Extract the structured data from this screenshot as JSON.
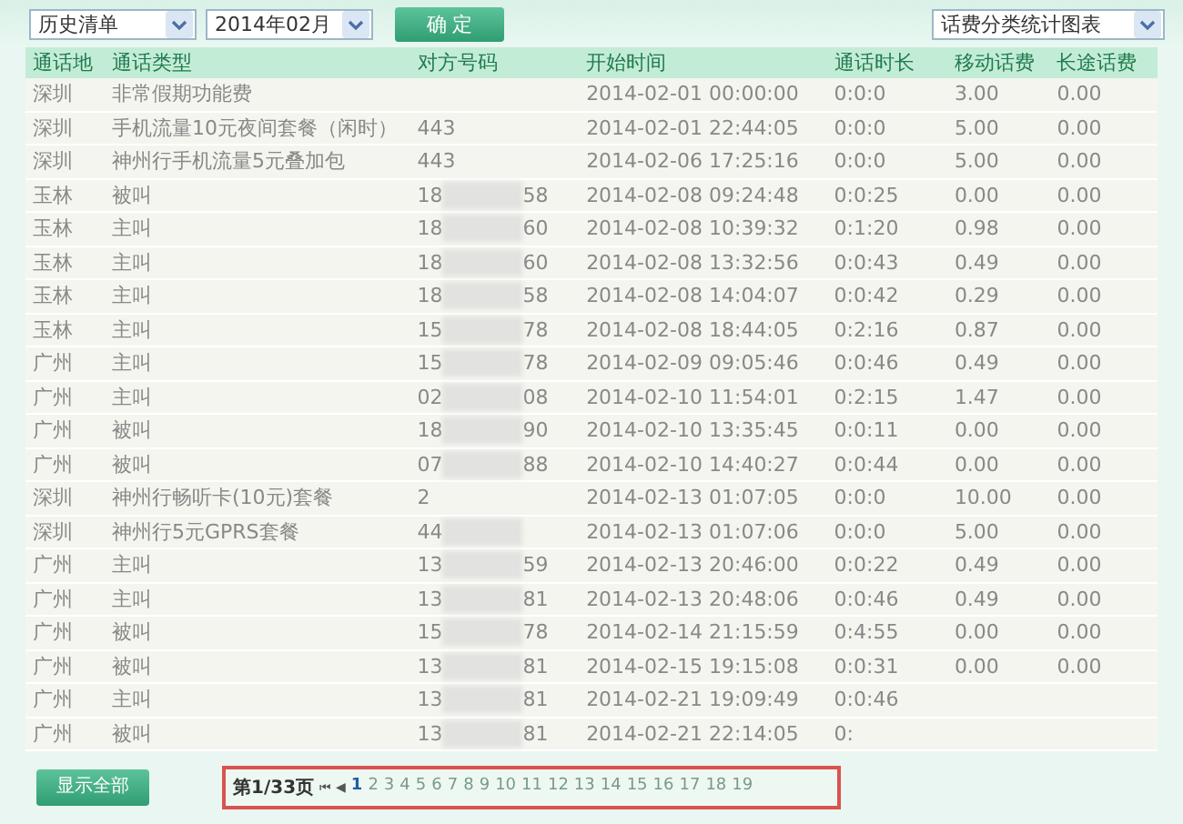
{
  "filters": {
    "list_type": "历史清单",
    "month": "2014年02月",
    "confirm": "确 定",
    "chart_select": "话费分类统计图表"
  },
  "table": {
    "columns": [
      "通话地",
      "通话类型",
      "对方号码",
      "开始时间",
      "通话时长",
      "移动话费",
      "长途话费"
    ],
    "rows": [
      {
        "place": "深圳",
        "type": "非常假期功能费",
        "number_start": "",
        "number_end": "",
        "blurred": false,
        "start": "2014-02-01 00:00:00",
        "duration": "0:0:0",
        "mobile_fee": "3.00",
        "long_fee": "0.00"
      },
      {
        "place": "深圳",
        "type": "手机流量10元夜间套餐（闲时）",
        "number_start": "443",
        "number_end": "",
        "blurred": false,
        "start": "2014-02-01 22:44:05",
        "duration": "0:0:0",
        "mobile_fee": "5.00",
        "long_fee": "0.00"
      },
      {
        "place": "深圳",
        "type": "神州行手机流量5元叠加包",
        "number_start": "443",
        "number_end": "",
        "blurred": false,
        "start": "2014-02-06 17:25:16",
        "duration": "0:0:0",
        "mobile_fee": "5.00",
        "long_fee": "0.00"
      },
      {
        "place": "玉林",
        "type": "被叫",
        "number_start": "18",
        "number_end": "58",
        "blurred": true,
        "start": "2014-02-08 09:24:48",
        "duration": "0:0:25",
        "mobile_fee": "0.00",
        "long_fee": "0.00"
      },
      {
        "place": "玉林",
        "type": "主叫",
        "number_start": "18",
        "number_end": "60",
        "blurred": true,
        "start": "2014-02-08 10:39:32",
        "duration": "0:1:20",
        "mobile_fee": "0.98",
        "long_fee": "0.00"
      },
      {
        "place": "玉林",
        "type": "主叫",
        "number_start": "18",
        "number_end": "60",
        "blurred": true,
        "start": "2014-02-08 13:32:56",
        "duration": "0:0:43",
        "mobile_fee": "0.49",
        "long_fee": "0.00"
      },
      {
        "place": "玉林",
        "type": "主叫",
        "number_start": "18",
        "number_end": "58",
        "blurred": true,
        "start": "2014-02-08 14:04:07",
        "duration": "0:0:42",
        "mobile_fee": "0.29",
        "long_fee": "0.00"
      },
      {
        "place": "玉林",
        "type": "主叫",
        "number_start": "15",
        "number_end": "78",
        "blurred": true,
        "start": "2014-02-08 18:44:05",
        "duration": "0:2:16",
        "mobile_fee": "0.87",
        "long_fee": "0.00"
      },
      {
        "place": "广州",
        "type": "主叫",
        "number_start": "15",
        "number_end": "78",
        "blurred": true,
        "start": "2014-02-09 09:05:46",
        "duration": "0:0:46",
        "mobile_fee": "0.49",
        "long_fee": "0.00"
      },
      {
        "place": "广州",
        "type": "主叫",
        "number_start": "02",
        "number_end": "08",
        "blurred": true,
        "start": "2014-02-10 11:54:01",
        "duration": "0:2:15",
        "mobile_fee": "1.47",
        "long_fee": "0.00"
      },
      {
        "place": "广州",
        "type": "被叫",
        "number_start": "18",
        "number_end": "90",
        "blurred": true,
        "start": "2014-02-10 13:35:45",
        "duration": "0:0:11",
        "mobile_fee": "0.00",
        "long_fee": "0.00"
      },
      {
        "place": "广州",
        "type": "被叫",
        "number_start": "07",
        "number_end": "88",
        "blurred": true,
        "start": "2014-02-10 14:40:27",
        "duration": "0:0:44",
        "mobile_fee": "0.00",
        "long_fee": "0.00"
      },
      {
        "place": "深圳",
        "type": "神州行畅听卡(10元)套餐",
        "number_start": "2",
        "number_end": "",
        "blurred": false,
        "start": "2014-02-13 01:07:05",
        "duration": "0:0:0",
        "mobile_fee": "10.00",
        "long_fee": "0.00"
      },
      {
        "place": "深圳",
        "type": "神州行5元GPRS套餐",
        "number_start": "44",
        "number_end": "",
        "blurred": true,
        "start": "2014-02-13 01:07:06",
        "duration": "0:0:0",
        "mobile_fee": "5.00",
        "long_fee": "0.00"
      },
      {
        "place": "广州",
        "type": "主叫",
        "number_start": "13",
        "number_end": "59",
        "blurred": true,
        "start": "2014-02-13 20:46:00",
        "duration": "0:0:22",
        "mobile_fee": "0.49",
        "long_fee": "0.00"
      },
      {
        "place": "广州",
        "type": "主叫",
        "number_start": "13",
        "number_end": "81",
        "blurred": true,
        "start": "2014-02-13 20:48:06",
        "duration": "0:0:46",
        "mobile_fee": "0.49",
        "long_fee": "0.00"
      },
      {
        "place": "广州",
        "type": "被叫",
        "number_start": "15",
        "number_end": "78",
        "blurred": true,
        "start": "2014-02-14 21:15:59",
        "duration": "0:4:55",
        "mobile_fee": "0.00",
        "long_fee": "0.00"
      },
      {
        "place": "广州",
        "type": "被叫",
        "number_start": "13",
        "number_end": "81",
        "blurred": true,
        "start": "2014-02-15 19:15:08",
        "duration": "0:0:31",
        "mobile_fee": "0.00",
        "long_fee": "0.00"
      },
      {
        "place": "广州",
        "type": "主叫",
        "number_start": "13",
        "number_end": "81",
        "blurred": true,
        "start": "2014-02-21 19:09:49",
        "duration": "0:0:46",
        "mobile_fee": "",
        "long_fee": ""
      },
      {
        "place": "广州",
        "type": "被叫",
        "number_start": "13",
        "number_end": "81",
        "blurred": true,
        "start": "2014-02-21 22:14:05",
        "duration": "0:",
        "mobile_fee": "",
        "long_fee": ""
      }
    ]
  },
  "footer": {
    "show_all": "显示全部",
    "page_info": "第1/33页",
    "first": "⏮",
    "prev": "◀",
    "pages": [
      {
        "label": "1",
        "selected": true
      },
      {
        "label": "2",
        "selected": false
      },
      {
        "label": "3",
        "selected": false
      },
      {
        "label": "4",
        "selected": false
      },
      {
        "label": "5",
        "selected": false
      },
      {
        "label": "6",
        "selected": false
      },
      {
        "label": "7",
        "selected": false
      },
      {
        "label": "8",
        "selected": false
      },
      {
        "label": "9",
        "selected": false
      },
      {
        "label": "10",
        "selected": false
      },
      {
        "label": "11",
        "selected": false
      },
      {
        "label": "12",
        "selected": false
      },
      {
        "label": "13",
        "selected": false
      },
      {
        "label": "14",
        "selected": false
      },
      {
        "label": "15",
        "selected": false
      },
      {
        "label": "16",
        "selected": false
      },
      {
        "label": "17",
        "selected": false
      },
      {
        "label": "18",
        "selected": false
      },
      {
        "label": "19",
        "selected": false
      }
    ]
  }
}
